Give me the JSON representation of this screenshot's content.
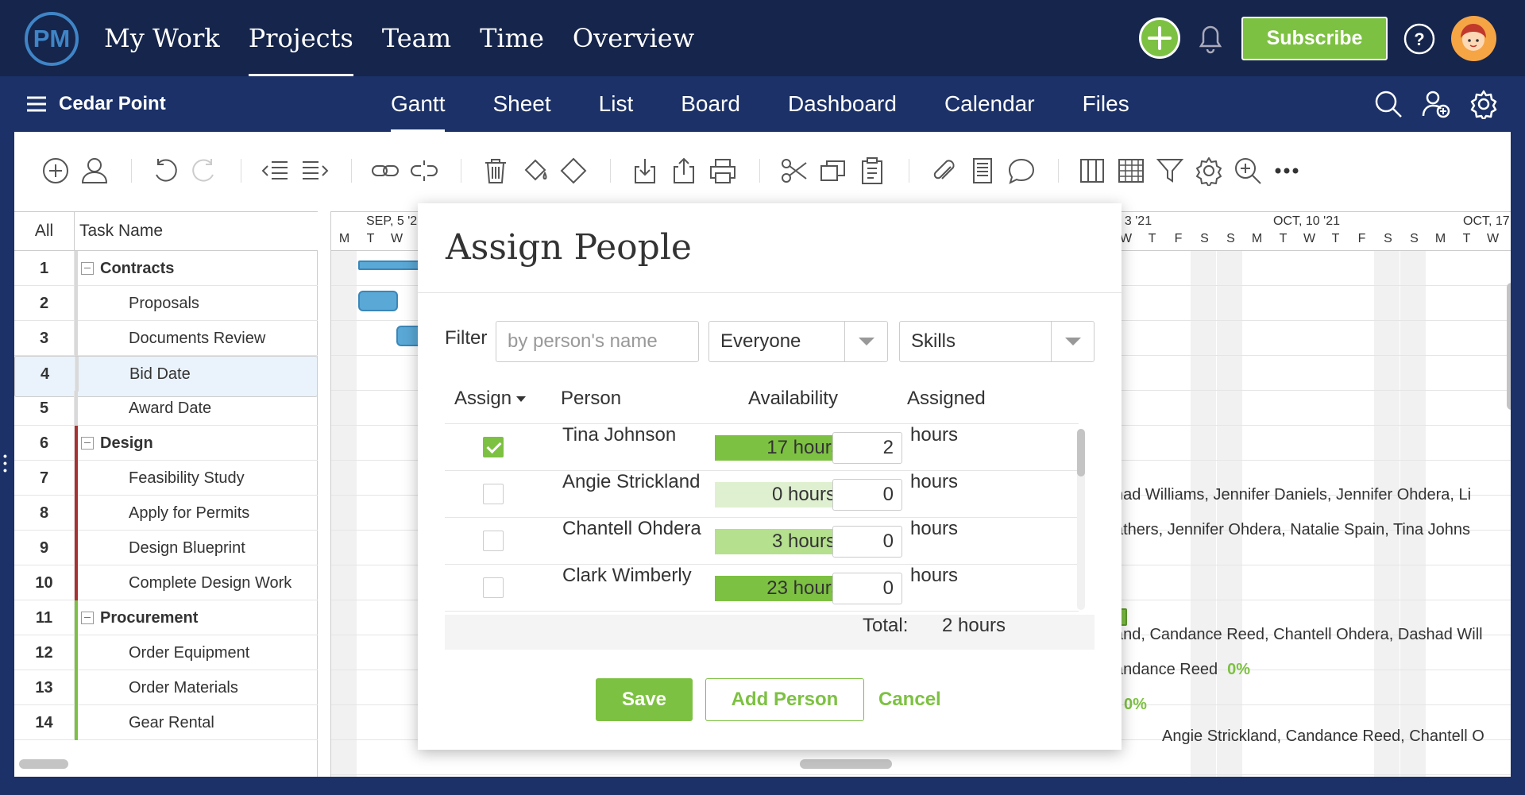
{
  "header": {
    "logo": "PM",
    "nav": [
      "My Work",
      "Projects",
      "Team",
      "Time",
      "Overview"
    ],
    "active_nav": 1,
    "subscribe_label": "Subscribe",
    "help_label": "?"
  },
  "project": {
    "name": "Cedar Point",
    "tabs": [
      "Gantt",
      "Sheet",
      "List",
      "Board",
      "Dashboard",
      "Calendar",
      "Files"
    ],
    "active_tab": 0
  },
  "grid": {
    "col_all": "All",
    "col_task": "Task Name",
    "rows": [
      {
        "num": "1",
        "name": "Contracts",
        "group": true
      },
      {
        "num": "2",
        "name": "Proposals",
        "group": false
      },
      {
        "num": "3",
        "name": "Documents Review",
        "group": false
      },
      {
        "num": "4",
        "name": "Bid Date",
        "group": false,
        "selected": true
      },
      {
        "num": "5",
        "name": "Award Date",
        "group": false
      },
      {
        "num": "6",
        "name": "Design",
        "group": true
      },
      {
        "num": "7",
        "name": "Feasibility Study",
        "group": false
      },
      {
        "num": "8",
        "name": "Apply for Permits",
        "group": false
      },
      {
        "num": "9",
        "name": "Design Blueprint",
        "group": false
      },
      {
        "num": "10",
        "name": "Complete Design Work",
        "group": false
      },
      {
        "num": "11",
        "name": "Procurement",
        "group": true
      },
      {
        "num": "12",
        "name": "Order Equipment",
        "group": false
      },
      {
        "num": "13",
        "name": "Order Materials",
        "group": false
      },
      {
        "num": "14",
        "name": "Gear Rental",
        "group": false
      }
    ]
  },
  "gantt": {
    "weeks": [
      "SEP, 5 '2",
      ", 3 '21",
      "OCT, 10 '21",
      "OCT, 17"
    ],
    "days_left": [
      "M",
      "T",
      "W"
    ],
    "days_right": [
      "W",
      "T",
      "F",
      "S",
      "S",
      "M",
      "T",
      "W",
      "T",
      "F",
      "S",
      "S",
      "M",
      "T",
      "W"
    ],
    "labels": [
      {
        "text": "had Williams, Jennifer Daniels, Jennifer Ohdera, Li",
        "pct": ""
      },
      {
        "text": "athers, Jennifer Ohdera, Natalie Spain, Tina Johns",
        "pct": ""
      },
      {
        "text": "and, Candance Reed, Chantell Ohdera, Dashad Will",
        "pct": ""
      },
      {
        "text": "andance Reed",
        "pct": "0%"
      },
      {
        "text": "",
        "pct": "0%"
      },
      {
        "text": "Angie Strickland, Candance Reed, Chantell O",
        "pct": ""
      }
    ]
  },
  "modal": {
    "title": "Assign People",
    "filter_label": "Filter",
    "filter_placeholder": "by person's name",
    "group_select": "Everyone",
    "skills_select": "Skills",
    "col_assign": "Assign",
    "col_person": "Person",
    "col_availability": "Availability",
    "col_assigned": "Assigned",
    "hours_unit": "hours",
    "people": [
      {
        "name": "Tina Johnson",
        "availability": "17 hours",
        "assigned": "2",
        "checked": true,
        "color": "#7dc142"
      },
      {
        "name": "Angie Strickland",
        "availability": "0 hours",
        "assigned": "0",
        "checked": false,
        "color": "#dff0d0"
      },
      {
        "name": "Chantell Ohdera",
        "availability": "3 hours",
        "assigned": "0",
        "checked": false,
        "color": "#b5e08e"
      },
      {
        "name": "Clark Wimberly",
        "availability": "23 hours",
        "assigned": "0",
        "checked": false,
        "color": "#7dc142"
      }
    ],
    "total_label": "Total:",
    "total_value": "2 hours",
    "save_label": "Save",
    "add_person_label": "Add Person",
    "cancel_label": "Cancel"
  },
  "colors": {
    "topbar": "#16254b",
    "subbar": "#1b3167",
    "accent_green": "#7dc142",
    "logo_blue": "#3f85c7",
    "contracts_bar": "#d9d9d9",
    "design_bar": "#a83232",
    "procurement_bar": "#7dc142"
  }
}
